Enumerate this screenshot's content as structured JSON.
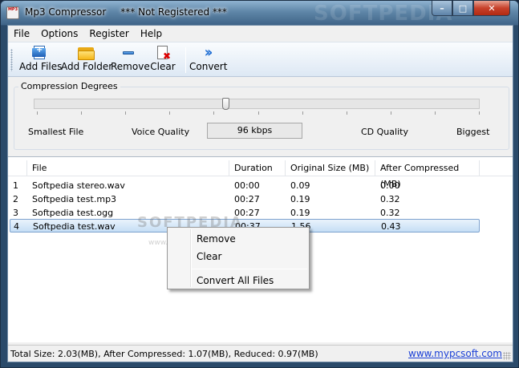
{
  "window": {
    "title": "Mp3 Compressor",
    "registration": "*** Not Registered ***",
    "background_watermark": "SOFTPEDIA",
    "icon_label": "MP3"
  },
  "menu": [
    "File",
    "Options",
    "Register",
    "Help"
  ],
  "toolbar": {
    "add_files": "Add Files",
    "add_folder": "Add Folder",
    "remove": "Remove",
    "clear": "Clear",
    "convert": "Convert"
  },
  "compression": {
    "legend": "Compression Degrees",
    "labels": [
      "Smallest File",
      "Voice Quality",
      "CD Quality",
      "Biggest"
    ],
    "value": "96 kbps",
    "slider_fraction": 0.43
  },
  "list": {
    "columns": [
      "File",
      "Duration",
      "Original Size (MB)",
      "After Compressed (MB)"
    ],
    "rows": [
      {
        "num": "1",
        "file": "Softpedia stereo.wav",
        "duration": "00:00",
        "original": "0.09",
        "compressed": "0.00"
      },
      {
        "num": "2",
        "file": "Softpedia test.mp3",
        "duration": "00:27",
        "original": "0.19",
        "compressed": "0.32"
      },
      {
        "num": "3",
        "file": "Softpedia test.ogg",
        "duration": "00:27",
        "original": "0.19",
        "compressed": "0.32"
      },
      {
        "num": "4",
        "file": "Softpedia test.wav",
        "duration": "00:37",
        "original": "1.56",
        "compressed": "0.43"
      }
    ],
    "selected_row": "4"
  },
  "context_menu": {
    "remove": "Remove",
    "clear": "Clear",
    "convert_all": "Convert All Files"
  },
  "watermark": {
    "big": "SOFTPEDIA",
    "small": "www.softpedia.com"
  },
  "status": {
    "summary": "Total Size: 2.03(MB), After Compressed: 1.07(MB), Reduced: 0.97(MB)",
    "link": "www.mypcsoft.com"
  },
  "colors": {
    "link": "#1a3fd6",
    "selection": "#c5def5",
    "close_button": "#c7412b"
  }
}
